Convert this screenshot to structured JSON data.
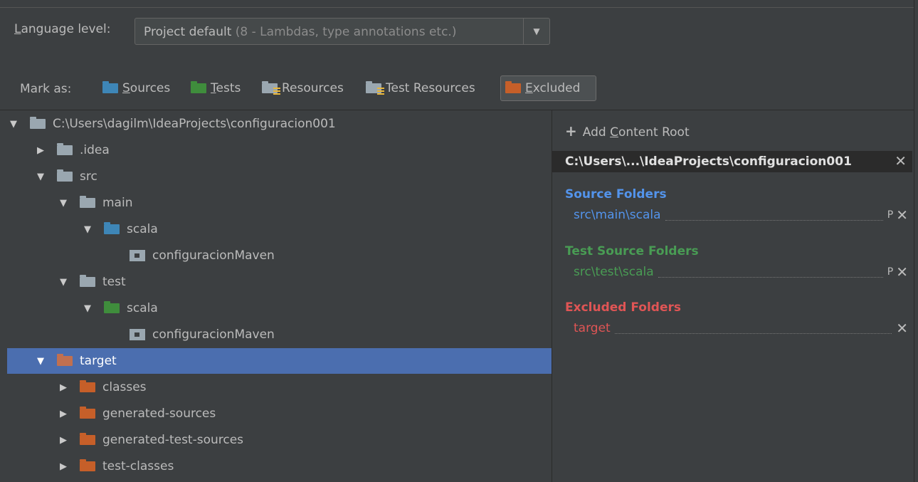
{
  "language_level": {
    "label_prefix": "L",
    "label_rest": "anguage level:",
    "value_main": "Project default",
    "value_hint": " (8 - Lambdas, type annotations etc.)"
  },
  "mark_as": {
    "label": "Mark as:",
    "buttons": [
      {
        "mnemonic": "S",
        "rest": "ources",
        "icon": "sources-folder-icon",
        "color": "#3e86b7"
      },
      {
        "mnemonic": "T",
        "rest": "ests",
        "icon": "tests-folder-icon",
        "color": "#3f8d3c"
      },
      {
        "mnemonic": "",
        "rest": "Resources",
        "icon": "resources-folder-icon",
        "color": "#9aa7b0"
      },
      {
        "mnemonic": "",
        "rest": "Test Resources",
        "icon": "test-resources-folder-icon",
        "color": "#9aa7b0"
      },
      {
        "mnemonic": "E",
        "rest": "xcluded",
        "icon": "excluded-folder-icon",
        "color": "#c65f29",
        "active": true
      }
    ]
  },
  "tree": [
    {
      "label": "C:\\Users\\dagilm\\IdeaProjects\\configuracion001",
      "expanded": true,
      "icon": "folder-icon"
    },
    {
      "label": ".idea",
      "expanded": false,
      "icon": "folder-icon"
    },
    {
      "label": "src",
      "expanded": true,
      "icon": "folder-icon"
    },
    {
      "label": "main",
      "expanded": true,
      "icon": "folder-icon"
    },
    {
      "label": "scala",
      "expanded": true,
      "icon": "source-folder-icon"
    },
    {
      "label": "configuracionMaven",
      "icon": "package-icon"
    },
    {
      "label": "test",
      "expanded": true,
      "icon": "folder-icon"
    },
    {
      "label": "scala",
      "expanded": true,
      "icon": "test-folder-icon"
    },
    {
      "label": "configuracionMaven",
      "icon": "package-icon"
    },
    {
      "label": "target",
      "expanded": true,
      "icon": "excluded-folder-icon",
      "selected": true
    },
    {
      "label": "classes",
      "expanded": false,
      "icon": "excluded-folder-icon"
    },
    {
      "label": "generated-sources",
      "expanded": false,
      "icon": "excluded-folder-icon"
    },
    {
      "label": "generated-test-sources",
      "expanded": false,
      "icon": "excluded-folder-icon"
    },
    {
      "label": "test-classes",
      "expanded": false,
      "icon": "excluded-folder-icon"
    }
  ],
  "right_panel": {
    "add_root_prefix": "Add ",
    "add_root_mnemonic": "C",
    "add_root_rest": "ontent Root",
    "root_path": "C:\\Users\\...\\IdeaProjects\\configuracion001",
    "source_title": "Source Folders",
    "source_item": "src\\main\\scala",
    "test_title": "Test Source Folders",
    "test_item": "src\\test\\scala",
    "excluded_title": "Excluded Folders",
    "excluded_item": "target",
    "p_glyph": "P",
    "close_glyph": "✕"
  },
  "colors": {
    "background": "#3c3f41",
    "selection": "#4b6eaf",
    "source": "#5394ec",
    "test": "#499c54",
    "excluded": "#e05555"
  }
}
